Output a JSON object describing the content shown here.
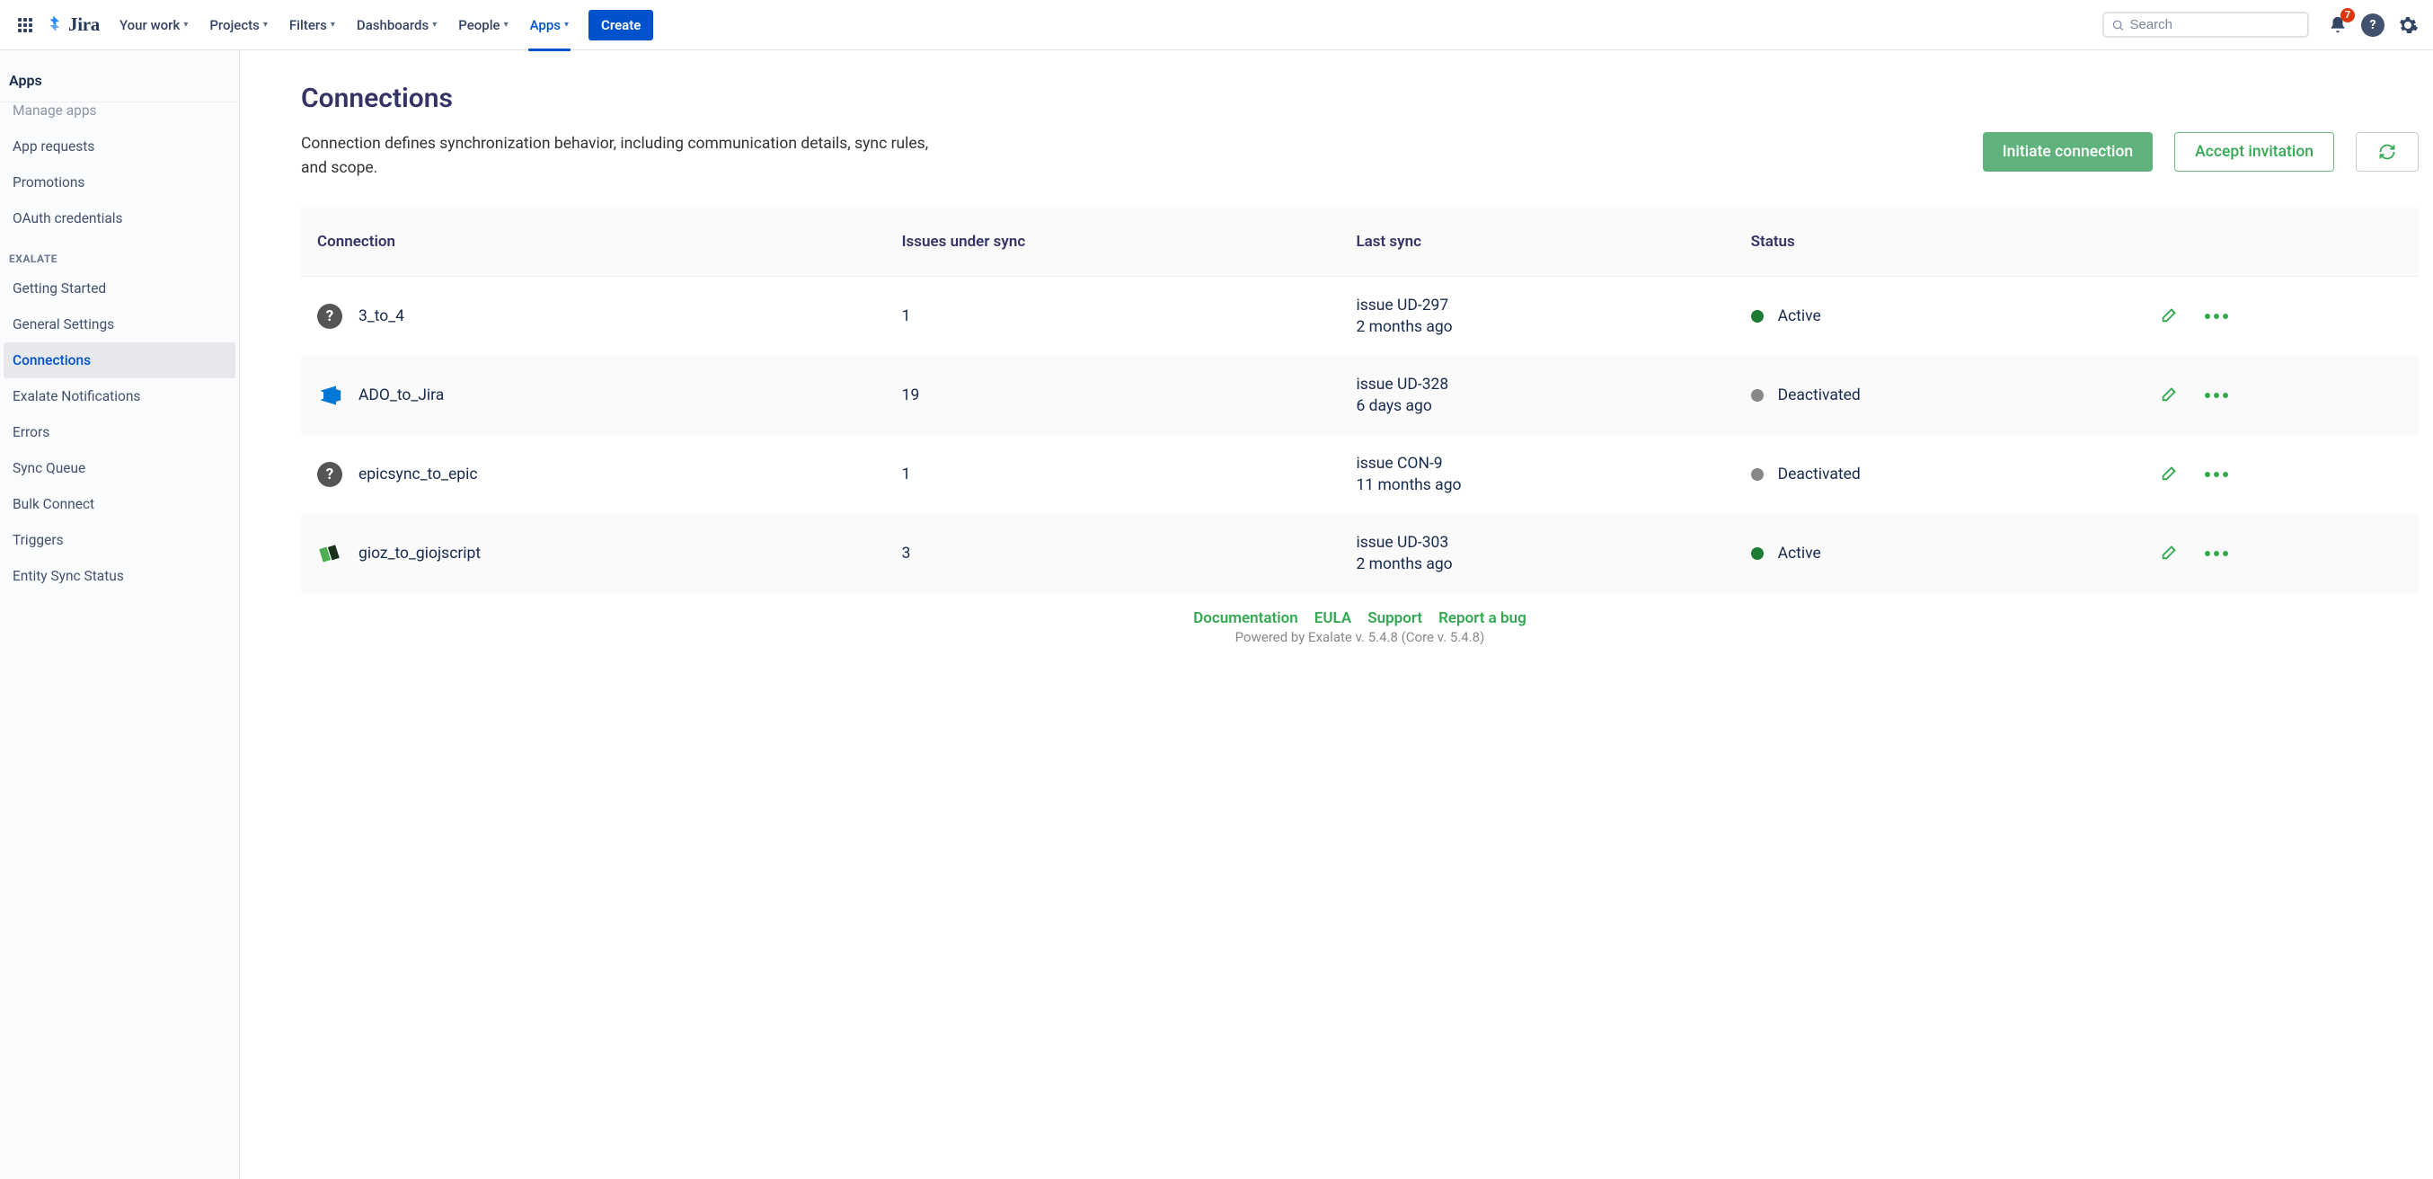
{
  "topbar": {
    "product_name": "Jira",
    "nav": [
      {
        "label": "Your work",
        "has_menu": true
      },
      {
        "label": "Projects",
        "has_menu": true
      },
      {
        "label": "Filters",
        "has_menu": true
      },
      {
        "label": "Dashboards",
        "has_menu": true
      },
      {
        "label": "People",
        "has_menu": true
      },
      {
        "label": "Apps",
        "has_menu": true,
        "active": true
      }
    ],
    "create_label": "Create",
    "search_placeholder": "Search",
    "notification_count": "7"
  },
  "sidebar": {
    "title": "Apps",
    "truncated_item": "Manage apps",
    "items_a": [
      "App requests",
      "Promotions",
      "OAuth credentials"
    ],
    "section_label": "EXALATE",
    "items_b": [
      {
        "label": "Getting Started"
      },
      {
        "label": "General Settings"
      },
      {
        "label": "Connections",
        "selected": true
      },
      {
        "label": "Exalate Notifications"
      },
      {
        "label": "Errors"
      },
      {
        "label": "Sync Queue"
      },
      {
        "label": "Bulk Connect"
      },
      {
        "label": "Triggers"
      },
      {
        "label": "Entity Sync Status"
      }
    ]
  },
  "page": {
    "title": "Connections",
    "description": "Connection defines synchronization behavior, including communication details, sync rules, and scope.",
    "btn_initiate": "Initiate connection",
    "btn_accept": "Accept invitation"
  },
  "table": {
    "columns": [
      "Connection",
      "Issues under sync",
      "Last sync",
      "Status"
    ],
    "rows": [
      {
        "icon": "unknown",
        "name": "3_to_4",
        "issues": "1",
        "last_issue": "issue UD-297",
        "last_time": "2 months ago",
        "status": "Active",
        "status_kind": "green"
      },
      {
        "icon": "ado",
        "name": "ADO_to_Jira",
        "issues": "19",
        "last_issue": "issue UD-328",
        "last_time": "6 days ago",
        "status": "Deactivated",
        "status_kind": "gray"
      },
      {
        "icon": "unknown",
        "name": "epicsync_to_epic",
        "issues": "1",
        "last_issue": "issue CON-9",
        "last_time": "11 months ago",
        "status": "Deactivated",
        "status_kind": "gray"
      },
      {
        "icon": "green",
        "name": "gioz_to_giojscript",
        "issues": "3",
        "last_issue": "issue UD-303",
        "last_time": "2 months ago",
        "status": "Active",
        "status_kind": "green"
      }
    ]
  },
  "footer": {
    "links": [
      "Documentation",
      "EULA",
      "Support",
      "Report a bug"
    ],
    "version": "Powered by Exalate v. 5.4.8 (Core v. 5.4.8)"
  }
}
